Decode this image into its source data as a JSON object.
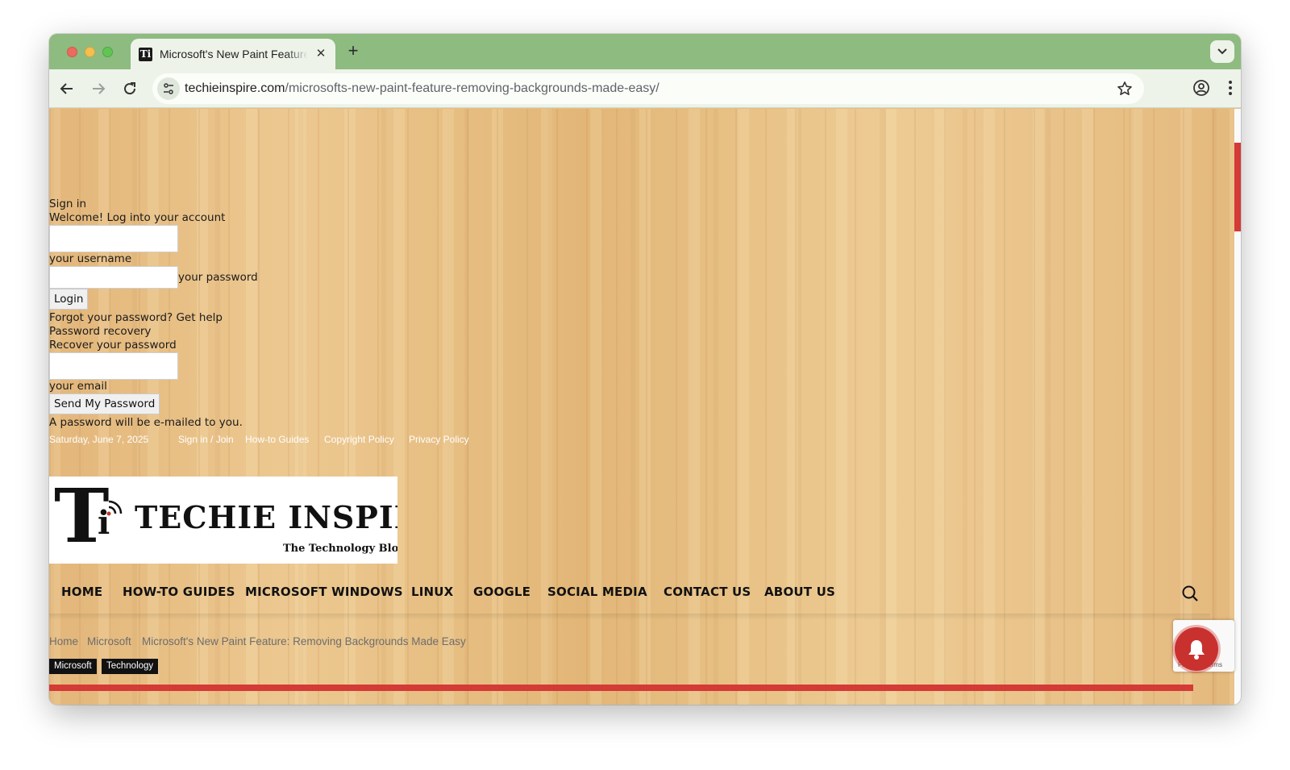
{
  "browser": {
    "tab_title": "Microsoft's New Paint Feature: Removing Backgrounds Made Easy",
    "favicon_text": "Ti",
    "url_domain": "techieinspire.com",
    "url_path": "/microsofts-new-paint-feature-removing-backgrounds-made-easy/"
  },
  "login": {
    "sign_in": "Sign in",
    "welcome": "Welcome! Log into your account",
    "username_label": "your username",
    "password_label": "your password",
    "login_button": "Login",
    "forgot": "Forgot your password? Get help",
    "recovery_title": "Password recovery",
    "recover_label": "Recover your password",
    "email_label": "your email",
    "send_button": "Send My Password",
    "note": "A password will be e-mailed to you."
  },
  "topbar": {
    "date": "Saturday, June 7, 2025",
    "links": [
      "Sign in / Join",
      "How-to Guides",
      "Copyright Policy",
      "Privacy Policy"
    ]
  },
  "logo": {
    "mark": "T",
    "mark_i": "i",
    "title": "TECHIE INSPIRE",
    "tagline": "The Technology Blog"
  },
  "nav": {
    "items": [
      "HOME",
      "HOW-TO GUIDES",
      "MICROSOFT WINDOWS",
      "LINUX",
      "GOOGLE",
      "SOCIAL MEDIA",
      "CONTACT US",
      "ABOUT US"
    ]
  },
  "breadcrumb": [
    "Home",
    "Microsoft",
    "Microsoft's New Paint Feature: Removing Backgrounds Made Easy"
  ],
  "categories": [
    "Microsoft",
    "Technology"
  ],
  "recaptcha": {
    "text": "Privacy - Terms"
  },
  "colors": {
    "tab_strip": "#8dbb80",
    "accent_red": "#d43a36",
    "wood": "#e7be84"
  }
}
